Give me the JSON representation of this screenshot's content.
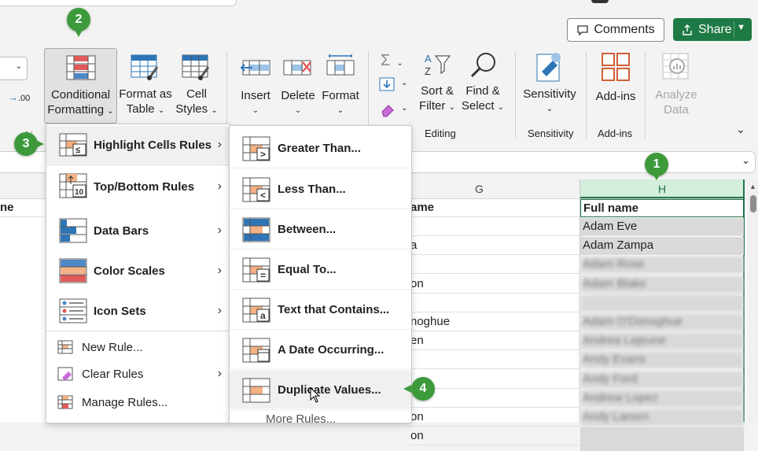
{
  "header": {
    "comments_label": "Comments",
    "share_label": "Share"
  },
  "ribbon": {
    "conditional_formatting": [
      "Conditional",
      "Formatting"
    ],
    "format_as_table": [
      "Format as",
      "Table"
    ],
    "cell_styles": [
      "Cell",
      "Styles"
    ],
    "insert": "Insert",
    "delete": "Delete",
    "format": "Format",
    "sort_filter": [
      "Sort &",
      "Filter"
    ],
    "find_select": [
      "Find &",
      "Select"
    ],
    "sensitivity": "Sensitivity",
    "addins": "Add-ins",
    "analyze_data": [
      "Analyze",
      "Data"
    ],
    "group_editing": "Editing",
    "group_sensitivity": "Sensitivity",
    "group_addins": "Add-ins",
    "decimal_label": ".00"
  },
  "sheet": {
    "col_g": "G",
    "col_h": "H",
    "header_left": "ne",
    "header_g": "ame",
    "header_h": "Full name",
    "g_values": [
      "",
      "a",
      "",
      "on",
      "",
      "noghue",
      "en",
      "",
      "",
      "",
      "on",
      "on"
    ],
    "h_values": [
      "Adam  Eve",
      "Adam  Zampa",
      "Adam  Rose",
      "Adam  Blake",
      "",
      "Adam  O'Donoghue",
      "Andrea  Lejeune",
      "Andy  Evans",
      "Andy  Ford",
      "Andrew  Lopez",
      "Andy  Larsen"
    ]
  },
  "cf_menu": {
    "items": [
      {
        "label": "Highlight Cells Rules",
        "submenu": true
      },
      {
        "label": "Top/Bottom Rules",
        "submenu": true
      },
      {
        "label": "Data Bars",
        "submenu": true
      },
      {
        "label": "Color Scales",
        "submenu": true
      },
      {
        "label": "Icon Sets",
        "submenu": true
      },
      {
        "label": "New Rule...",
        "submenu": false
      },
      {
        "label": "Clear Rules",
        "submenu": true
      },
      {
        "label": "Manage Rules...",
        "submenu": false
      }
    ]
  },
  "hl_menu": {
    "items": [
      {
        "label": "Greater Than..."
      },
      {
        "label": "Less Than..."
      },
      {
        "label": "Between..."
      },
      {
        "label": "Equal To..."
      },
      {
        "label": "Text that Contains..."
      },
      {
        "label": "A Date Occurring..."
      },
      {
        "label": "Duplicate Values..."
      },
      {
        "label": "More Rules..."
      }
    ]
  },
  "badges": {
    "b1": "1",
    "b2": "2",
    "b3": "3",
    "b4": "4"
  },
  "colors": {
    "accent_green": "#217346",
    "share_green": "#1e7a44",
    "badge_green": "#3d9a3b",
    "icon_orange": "#f4b183",
    "icon_blue": "#2e75b6",
    "icon_red": "#e05a5a"
  }
}
